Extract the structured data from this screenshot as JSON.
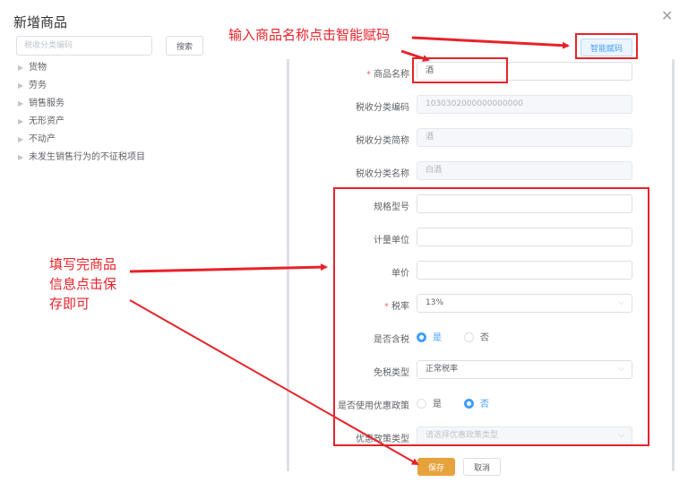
{
  "dialog": {
    "title": "新增商品",
    "close_icon": "close-icon"
  },
  "sidebar": {
    "search_placeholder": "税收分类编码",
    "search_button": "搜索",
    "tree": [
      "货物",
      "劳务",
      "销售服务",
      "无形资产",
      "不动产",
      "未发生销售行为的不征税项目"
    ]
  },
  "form": {
    "smart_code_button": "智能赋码",
    "product_name": {
      "label": "商品名称",
      "value": "酒"
    },
    "tax_code": {
      "label": "税收分类编码",
      "value": "1030302000000000000"
    },
    "tax_short_name": {
      "label": "税收分类简称",
      "value": "酒"
    },
    "tax_class_name": {
      "label": "税收分类名称",
      "value": "白酒"
    },
    "spec_model": {
      "label": "规格型号",
      "value": ""
    },
    "unit": {
      "label": "计量单位",
      "value": ""
    },
    "unit_price": {
      "label": "单价",
      "value": ""
    },
    "tax_rate": {
      "label": "税率",
      "value": "13%"
    },
    "tax_included": {
      "label": "是否含税",
      "options": [
        "是",
        "否"
      ],
      "selected": "是"
    },
    "exempt_type": {
      "label": "免税类型",
      "value": "正常税率"
    },
    "use_preferential": {
      "label": "是否使用优惠政策",
      "options": [
        "是",
        "否"
      ],
      "selected": "否"
    },
    "policy_type": {
      "label": "优惠政策类型",
      "placeholder": "请选择优惠政策类型"
    },
    "save_button": "保存",
    "cancel_button": "取消"
  },
  "annotations": {
    "top": "输入商品名称点击智能赋码",
    "left_lines": [
      "填写完商品",
      "信息点击保",
      "存即可"
    ]
  },
  "colors": {
    "annotation_red": "#e8222a",
    "primary_blue": "#409eff",
    "save_orange": "#e6a23c"
  }
}
